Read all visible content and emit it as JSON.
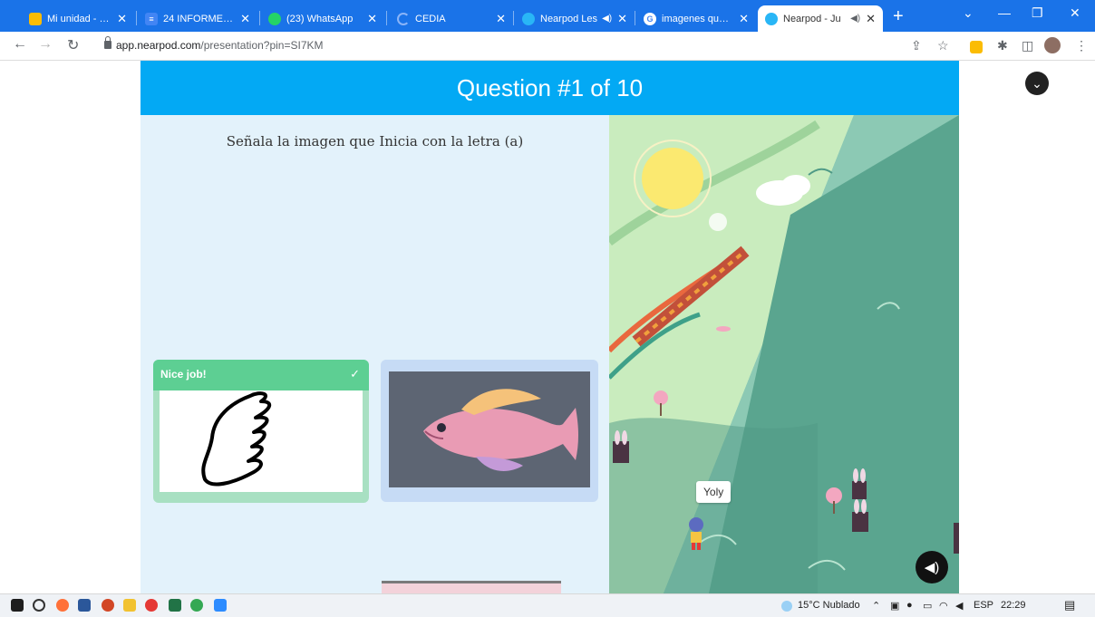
{
  "browser": {
    "tabs": [
      {
        "title": "Mi unidad - Goo",
        "favicon_color": "#fbbc04",
        "favicon": "drive-icon",
        "speaker": false
      },
      {
        "title": "24 INFORME: YA",
        "favicon_color": "#4285f4",
        "favicon": "docs-icon",
        "speaker": false
      },
      {
        "title": "(23) WhatsApp",
        "favicon_color": "#25d366",
        "favicon": "whatsapp-icon",
        "speaker": false
      },
      {
        "title": "CEDIA",
        "favicon_color": "#8ab4f8",
        "favicon": "loading-icon",
        "speaker": false
      },
      {
        "title": "Nearpod Les",
        "favicon_color": "#29b6f6",
        "favicon": "nearpod-icon",
        "speaker": true
      },
      {
        "title": "imagenes que te",
        "favicon_color": "#ffffff",
        "favicon": "google-icon",
        "speaker": false
      },
      {
        "title": "Nearpod - Ju",
        "favicon_color": "#29b6f6",
        "favicon": "nearpod-icon",
        "speaker": true,
        "active": true
      }
    ],
    "new_tab": "+",
    "address": {
      "host": "app.nearpod.com",
      "path": "/presentation?pin=SI7KM"
    }
  },
  "header": {
    "title": "Question #1 of 10"
  },
  "question": {
    "prompt": "Señala la imagen que Inicia con la letra (a)"
  },
  "answers": [
    {
      "banner": "Nice job!",
      "image": "wing-drawing",
      "status": "correct"
    },
    {
      "image": "fish-photo",
      "status": "unselected"
    }
  ],
  "game": {
    "player_name": "Yoly"
  },
  "taskbar": {
    "weather": "15°C  Nublado",
    "language": "ESP",
    "time": "22:29"
  },
  "colors": {
    "tabstrip": "#1a73e8",
    "header": "#03a9f4",
    "left_panel": "#e3f2fb",
    "correct_banner": "#5dcf93",
    "correct_card": "#a8e0c2",
    "selected_card": "#c6dbf5"
  }
}
